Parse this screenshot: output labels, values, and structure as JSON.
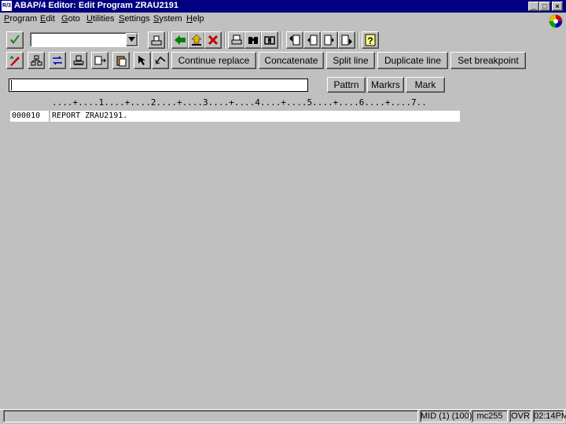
{
  "window": {
    "title": "ABAP/4 Editor: Edit Program ZRAU2191",
    "icon": "R/3",
    "controls": [
      "_",
      "□",
      "×"
    ]
  },
  "menu": [
    {
      "label": "Program",
      "u": "P",
      "rest": "rogram"
    },
    {
      "label": "Edit",
      "u": "E",
      "rest": "dit"
    },
    {
      "label": "Goto",
      "u": "G",
      "rest": "oto"
    },
    {
      "label": "Utilities",
      "u": "U",
      "rest": "tilities"
    },
    {
      "label": "Settings",
      "u": "S",
      "rest": "ettings"
    },
    {
      "label": "System",
      "u": "S",
      "rest": "ystem"
    },
    {
      "label": "Help",
      "u": "H",
      "rest": "elp"
    }
  ],
  "command_field": {
    "value": "",
    "placeholder": ""
  },
  "app_buttons": {
    "continue_replace": "Continue replace",
    "concatenate": "Concatenate",
    "split_line": "Split line",
    "duplicate_line": "Duplicate line",
    "set_breakpoint": "Set breakpoint"
  },
  "find_input": {
    "value": ""
  },
  "side_buttons": {
    "pattern": "Pattrn",
    "markers": "Markrs",
    "mark": "Mark"
  },
  "editor": {
    "ruler": "....+....1....+....2....+....3....+....4....+....5....+....6....+....7..",
    "lines": [
      {
        "number": "000010",
        "text": "REPORT ZRAU2191."
      }
    ]
  },
  "status": {
    "mid": "MID (1) (100)",
    "server": "mc255",
    "mode": "OVR",
    "time": "02:14PM"
  },
  "colors": {
    "title_bar": "#000080",
    "background": "#c0c0c0",
    "check_green": "#008000",
    "red": "#c00000"
  }
}
